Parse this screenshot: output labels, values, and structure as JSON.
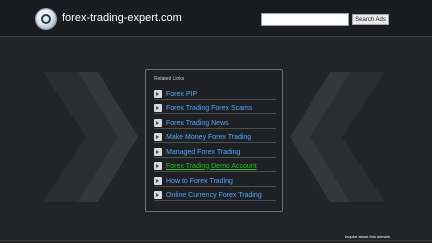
{
  "header": {
    "site_title": "forex-trading-expert.com",
    "search_placeholder": "",
    "search_button_label": "Search Ads"
  },
  "panel": {
    "title": "Related Links",
    "links": [
      {
        "label": "Forex PIP"
      },
      {
        "label": "Forex Trading Forex Scams"
      },
      {
        "label": "Forex Trading News"
      },
      {
        "label": "Make Money Forex Trading"
      },
      {
        "label": "Managed Forex Trading"
      },
      {
        "label": "Forex Trading Demo Account",
        "state": "hover"
      },
      {
        "label": "How to Forex Trading"
      },
      {
        "label": "Online Currency Forex Trading"
      }
    ]
  },
  "footer": {
    "inquire_label": "Inquire about this domain"
  },
  "icons": {
    "logo": "globe-logo-icon",
    "bullet": "arrow-bullet-icon",
    "decor": "chevron-icon"
  },
  "colors": {
    "background": "#222428",
    "header": "#1b1c1f",
    "link": "#4fa8ff",
    "link_active": "#26c026"
  }
}
